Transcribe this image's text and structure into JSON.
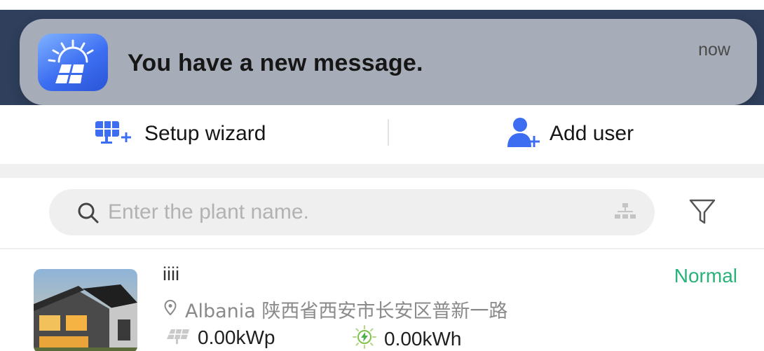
{
  "notification": {
    "message": "You have a new message.",
    "time": "now",
    "app_icon": "solar-panel-sun-icon"
  },
  "actions": {
    "setup_wizard_label": "Setup wizard",
    "setup_wizard_icon": "setup-wizard-icon",
    "add_user_label": "Add user",
    "add_user_icon": "add-user-icon"
  },
  "search": {
    "placeholder": "Enter the plant name.",
    "value": "",
    "org_icon": "org-structure-icon",
    "filter_icon": "filter-icon"
  },
  "plants": [
    {
      "name": "iiii",
      "status": "Normal",
      "location": "Albania 陕西省西安市长安区普新一路",
      "capacity": "0.00kWp",
      "energy": "0.00kWh"
    }
  ],
  "colors": {
    "accent_blue": "#3d6ef2",
    "status_normal": "#2ab27b",
    "header_dark": "#2f3f5c"
  }
}
